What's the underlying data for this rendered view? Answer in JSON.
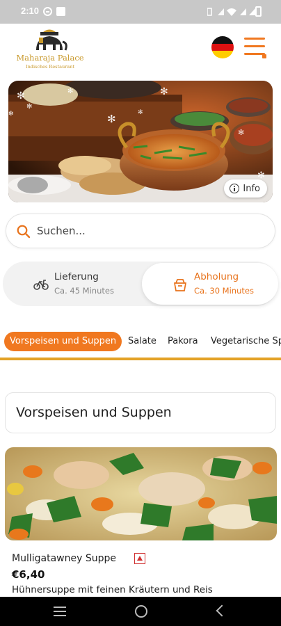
{
  "status_bar": {
    "time": "2:10",
    "icons": [
      "do-not-disturb-icon",
      "mail-icon",
      "vibrate-icon",
      "wifi-icon",
      "signal-icon",
      "signal-icon",
      "battery-icon"
    ]
  },
  "header": {
    "logo_name": "Maharaja Palace",
    "logo_subtitle": "Indisches Restaurant",
    "language_flag": "german-flag-icon",
    "menu_icon": "hamburger-menu-icon"
  },
  "hero": {
    "info_label": "Info"
  },
  "search": {
    "placeholder": "Suchen..."
  },
  "order_mode": {
    "delivery": {
      "title": "Lieferung",
      "subtitle": "Ca. 45 Minutes",
      "icon": "bicycle-icon"
    },
    "pickup": {
      "title": "Abholung",
      "subtitle": "Ca. 30 Minutes",
      "icon": "takeaway-bag-icon",
      "selected": true
    }
  },
  "categories": [
    {
      "label": "Vorspeisen und Suppen",
      "active": true
    },
    {
      "label": "Salate"
    },
    {
      "label": "Pakora"
    },
    {
      "label": "Vegetarische Sp"
    }
  ],
  "section": {
    "title": "Vorspeisen und Suppen"
  },
  "product": {
    "name": "Mulligatawney Suppe",
    "price": "€6,40",
    "description": "Hühnersuppe mit feinen Kräutern und Reis",
    "badge_icon": "spicy-icon"
  },
  "colors": {
    "accent": "#f07820",
    "gold": "#e3a227",
    "status_bar": "#c8c8c8"
  }
}
